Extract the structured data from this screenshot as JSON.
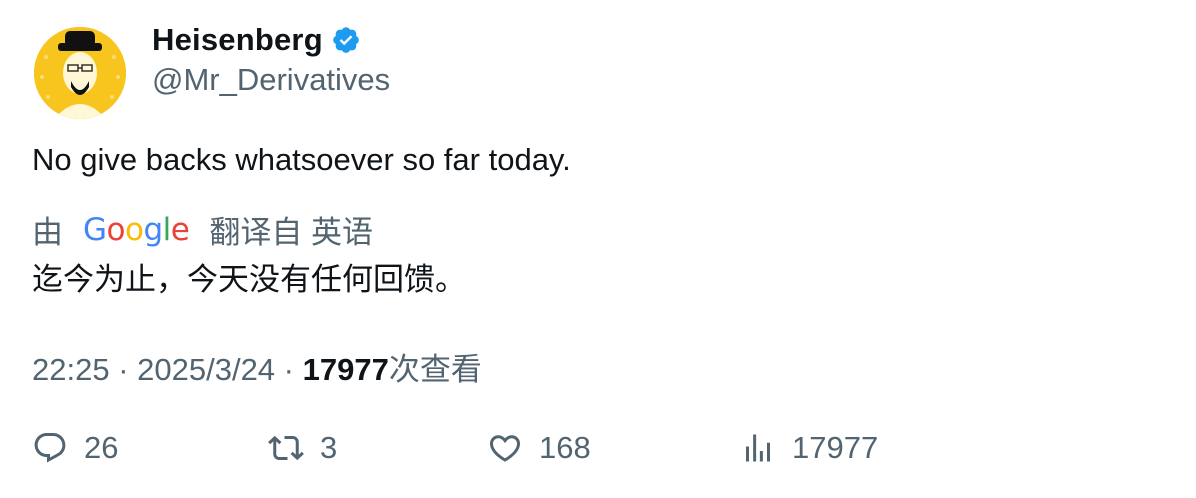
{
  "author": {
    "display_name": "Heisenberg",
    "handle": "@Mr_Derivatives",
    "verified_icon": "verified-badge-icon",
    "avatar_color": "#f7c51e"
  },
  "tweet": {
    "text": "No give backs whatsoever so far today."
  },
  "translation": {
    "by_label": "由",
    "provider_letters": [
      "G",
      "o",
      "o",
      "g",
      "l",
      "e"
    ],
    "from_label": "翻译自 英语",
    "text": "迄今为止，今天没有任何回馈。"
  },
  "meta": {
    "time": "22:25",
    "separator": " · ",
    "date": "2025/3/24",
    "views_count": "17977",
    "views_label": "次查看"
  },
  "actions": {
    "replies": "26",
    "retweets": "3",
    "likes": "168",
    "views": "17977"
  },
  "colors": {
    "text_primary": "#0f1419",
    "text_secondary": "#536471",
    "verified_blue": "#1d9bf0"
  }
}
